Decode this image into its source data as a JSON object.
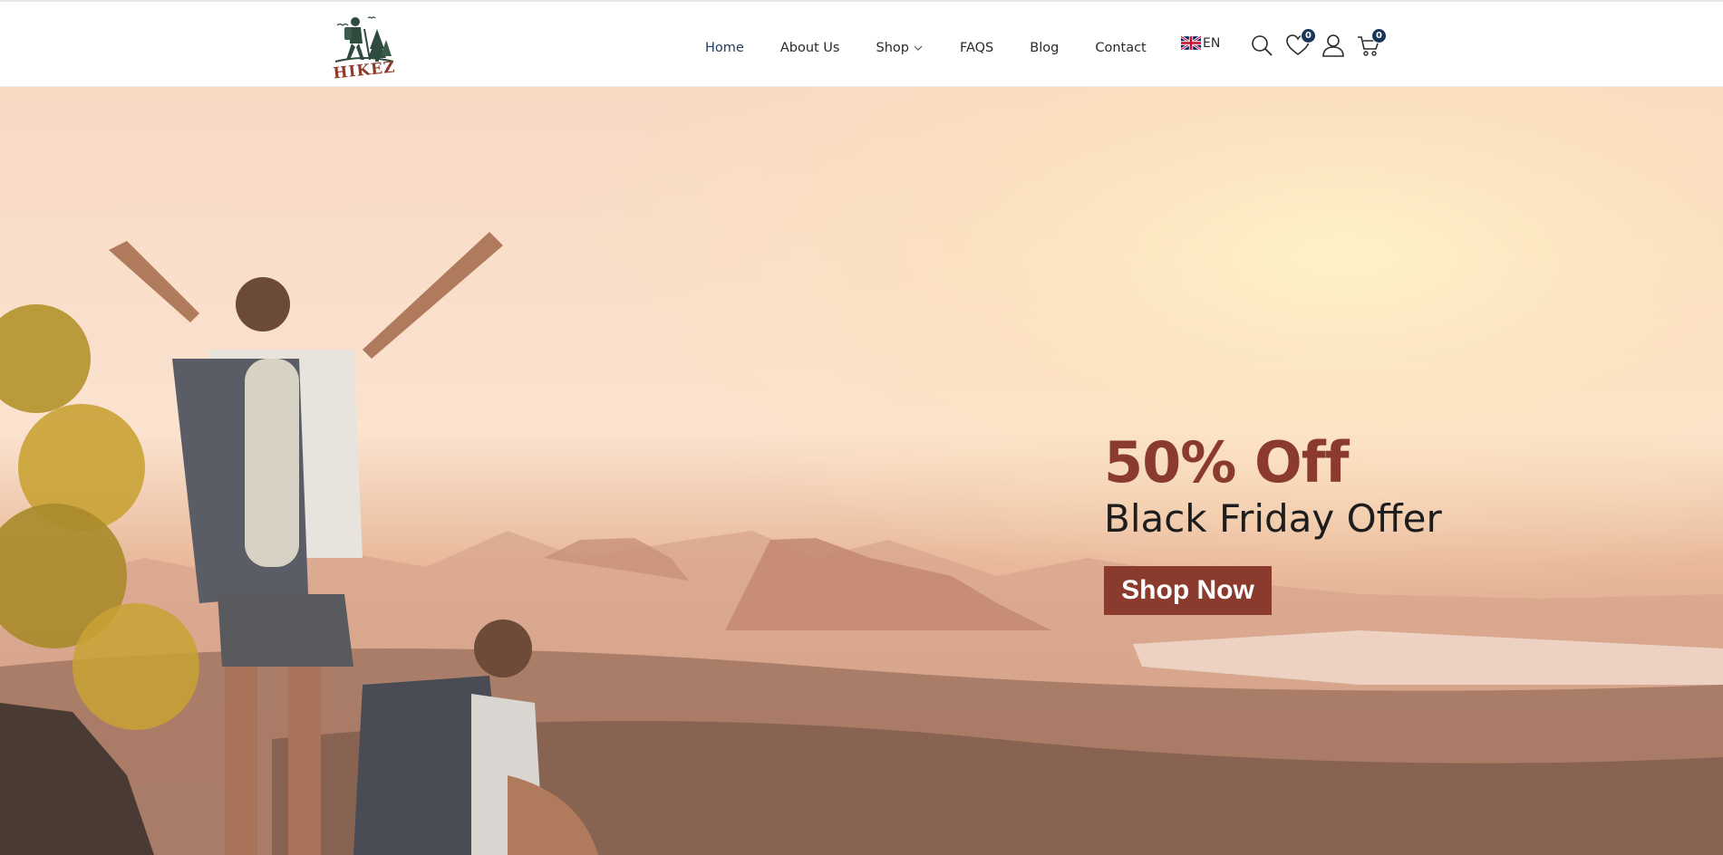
{
  "header": {
    "logo_text": "HIKEZ",
    "nav": [
      {
        "label": "Home",
        "active": true
      },
      {
        "label": "About Us"
      },
      {
        "label": "Shop",
        "has_dropdown": true
      },
      {
        "label": "FAQS"
      },
      {
        "label": "Blog"
      },
      {
        "label": "Contact"
      }
    ],
    "language": {
      "label": "EN",
      "flag": "uk-flag-icon"
    },
    "icons": {
      "search": "search-icon",
      "wishlist": "heart-icon",
      "account": "user-icon",
      "cart": "cart-icon"
    },
    "wishlist_count": "0",
    "cart_count": "0"
  },
  "hero": {
    "headline": "50% Off",
    "subheadline": "Black Friday Offer",
    "cta_label": "Shop Now"
  },
  "colors": {
    "accent": "#8a3b2e",
    "badge": "#1b3556",
    "nav_active": "#1f3a5f",
    "text": "#2a2a2a"
  }
}
